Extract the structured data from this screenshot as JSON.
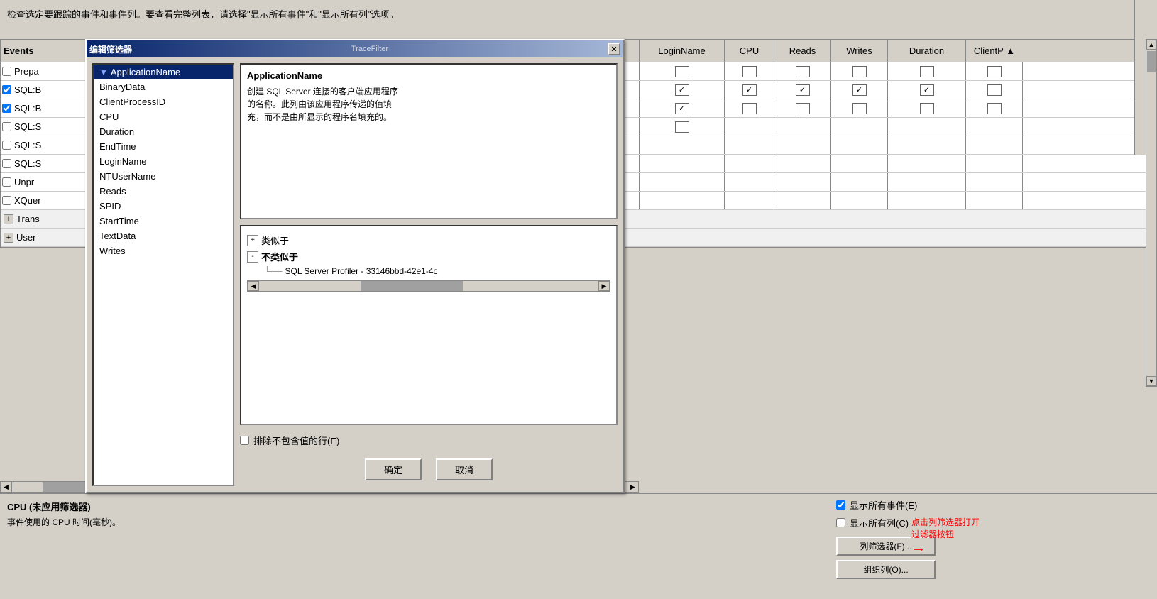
{
  "page": {
    "instruction": "检查选定要跟踪的事件和事件列。要查看完整列表，请选择\"显示所有事件\"和\"显示所有列\"选项。"
  },
  "table": {
    "headers": {
      "events": "Events",
      "loginname": "LoginName",
      "cpu": "CPU",
      "reads": "Reads",
      "writes": "Writes",
      "duration": "Duration",
      "clientp": "ClientP ▲"
    },
    "rows": [
      {
        "id": "row1",
        "name": "Prepa",
        "checked": false,
        "cpu": false,
        "reads": false,
        "writes": false,
        "duration": false,
        "loginname": false
      },
      {
        "id": "row2",
        "name": "SQL:B",
        "checked": true,
        "cpu": true,
        "reads": true,
        "writes": true,
        "duration": true,
        "loginname": true
      },
      {
        "id": "row3",
        "name": "SQL:B",
        "checked": true,
        "cpu": false,
        "reads": false,
        "writes": false,
        "duration": false,
        "loginname": true
      },
      {
        "id": "row4",
        "name": "SQL:S",
        "checked": false,
        "cpu": false,
        "reads": false,
        "writes": false,
        "duration": false,
        "loginname": false
      },
      {
        "id": "row5",
        "name": "SQL:S",
        "checked": false,
        "cpu": false,
        "reads": false,
        "writes": false,
        "duration": false,
        "loginname": false
      },
      {
        "id": "row6",
        "name": "SQL:S",
        "checked": false,
        "cpu": false,
        "reads": false,
        "writes": false,
        "duration": false,
        "loginname": false
      },
      {
        "id": "row7",
        "name": "Unpr",
        "checked": false,
        "cpu": false,
        "reads": false,
        "writes": false,
        "duration": false,
        "loginname": false
      },
      {
        "id": "row8",
        "name": "XQuer",
        "checked": false,
        "cpu": false,
        "reads": false,
        "writes": false,
        "duration": false,
        "loginname": false
      }
    ],
    "categories": [
      {
        "id": "cat1",
        "name": "Trans"
      },
      {
        "id": "cat2",
        "name": "User"
      }
    ]
  },
  "modal": {
    "title": "编辑筛选器",
    "title_bar_extra": "TraceFilter",
    "close_label": "✕",
    "column_list": [
      {
        "id": "col1",
        "label": "ApplicationName",
        "selected": true,
        "has_icon": true
      },
      {
        "id": "col2",
        "label": "BinaryData",
        "selected": false
      },
      {
        "id": "col3",
        "label": "ClientProcessID",
        "selected": false
      },
      {
        "id": "col4",
        "label": "CPU",
        "selected": false
      },
      {
        "id": "col5",
        "label": "Duration",
        "selected": false
      },
      {
        "id": "col6",
        "label": "EndTime",
        "selected": false
      },
      {
        "id": "col7",
        "label": "LoginName",
        "selected": false
      },
      {
        "id": "col8",
        "label": "NTUserName",
        "selected": false
      },
      {
        "id": "col9",
        "label": "Reads",
        "selected": false
      },
      {
        "id": "col10",
        "label": "SPID",
        "selected": false
      },
      {
        "id": "col11",
        "label": "StartTime",
        "selected": false
      },
      {
        "id": "col12",
        "label": "TextData",
        "selected": false
      },
      {
        "id": "col13",
        "label": "Writes",
        "selected": false
      }
    ],
    "description": {
      "title": "ApplicationName",
      "text": "创建 SQL Server 连接的客户端应用程序\n的名称。此列由该应用程序传递的值填\n充，而不是由所显示的程序名填充的。"
    },
    "criteria": {
      "similar_label": "+ 类似于",
      "not_similar_label": "- 不类似于",
      "not_similar_value": "SQL Server Profiler - 33146bbd-42e1-4c",
      "similar_expanded": false,
      "not_similar_expanded": true
    },
    "exclude_label": "排除不包含值的行(E)",
    "ok_label": "确定",
    "cancel_label": "取消"
  },
  "bottom": {
    "cpu_label": "CPU (未应用筛选器)",
    "cpu_desc": "事件使用的 CPU 时间(毫秒)。",
    "show_events_label": "显示所有事件(E)",
    "show_columns_label": "显示所有列(C)",
    "show_events_checked": true,
    "show_columns_checked": false,
    "annotation_text": "点击列筛选器打开\n过滤器按钮",
    "column_filter_label": "列筛选器(F)...",
    "organize_column_label": "组织列(O)..."
  }
}
